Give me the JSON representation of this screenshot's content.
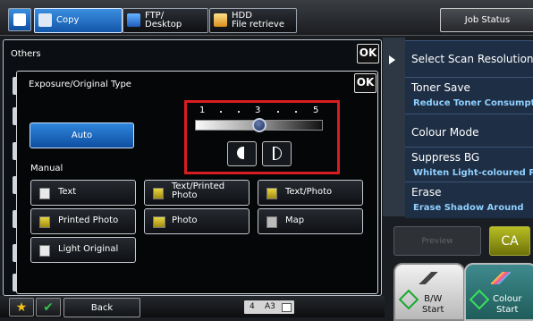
{
  "top_bar": {
    "tabs": [
      {
        "label": "Copy",
        "icon": "copy-icon"
      },
      {
        "label": "FTP/\nDesktop",
        "icon": "ftp-desktop-icon"
      },
      {
        "label": "HDD\nFile retrieve",
        "icon": "hdd-file-retrieve-icon"
      }
    ],
    "job_status": "Job Status"
  },
  "others_dialog": {
    "title": "Others",
    "ok": "OK"
  },
  "exposure_dialog": {
    "title": "Exposure/Original Type",
    "ok": "OK",
    "scale_min": "1",
    "scale_mid": "3",
    "scale_max": "5",
    "exposure_level": 3,
    "auto": "Auto",
    "manual": "Manual",
    "types": [
      {
        "label": "Text"
      },
      {
        "label": "Text/Printed\nPhoto"
      },
      {
        "label": "Text/Photo"
      },
      {
        "label": "Printed Photo"
      },
      {
        "label": "Photo"
      },
      {
        "label": "Map"
      },
      {
        "label": "Light Original"
      }
    ]
  },
  "right_panel": {
    "items": [
      {
        "title": "Select Scan Resolution",
        "sub": ""
      },
      {
        "title": "Toner Save",
        "sub": "Reduce Toner Consumption"
      },
      {
        "title": "Colour Mode",
        "sub": ""
      },
      {
        "title": "Suppress BG",
        "sub": "Whiten Light-coloured P"
      },
      {
        "title": "Erase",
        "sub": "Erase Shadow Around"
      }
    ],
    "preview": "Preview",
    "ca": "CA",
    "bw_start": "B/W\nStart",
    "colour_start": "Colour\nStart"
  },
  "bottom_bar": {
    "back": "Back",
    "tray_number": "4",
    "paper_size": "A3"
  },
  "colors": {
    "accent_blue": "#1356a8",
    "highlight_red": "#d81d22",
    "start_green": "#19a831"
  }
}
